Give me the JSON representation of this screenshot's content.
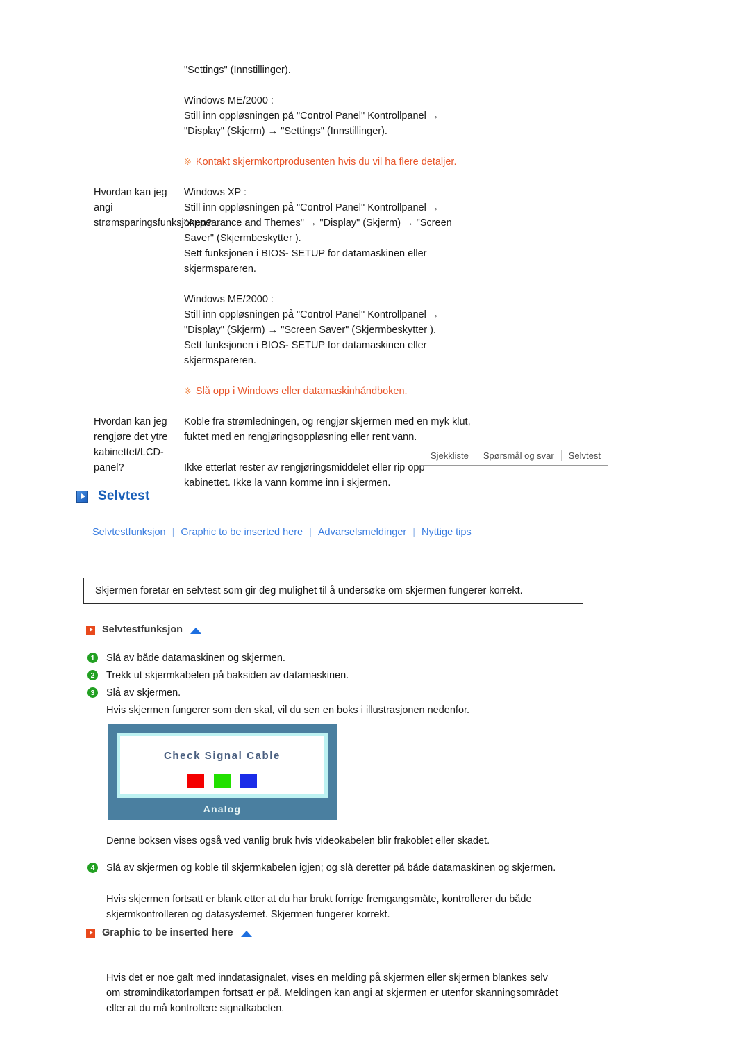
{
  "faq": {
    "rows": [
      {
        "question": "",
        "answer_blocks": [
          [
            "\"Settings\" (Innstillinger)."
          ],
          [
            "Windows ME/2000 :",
            "Still inn oppløsningen på \"Control Panel\" Kontrollpanel →",
            "\"Display\" (Skjerm) → \"Settings\" (Innstillinger)."
          ]
        ],
        "note": "Kontakt skjermkortprodusenten hvis du vil ha flere detaljer."
      },
      {
        "question_lines": [
          "Hvordan kan jeg angi",
          "strømsparingsfunksjonen?"
        ],
        "answer_blocks": [
          [
            "Windows XP :",
            "Still inn oppløsningen på \"Control Panel\" Kontrollpanel →",
            "\"Appearance and Themes\" → \"Display\" (Skjerm) → \"Screen",
            "Saver\" (Skjermbeskytter ).",
            "Sett funksjonen i BIOS- SETUP for datamaskinen eller",
            "skjermspareren."
          ],
          [
            "Windows ME/2000 :",
            "Still inn oppløsningen på \"Control Panel\" Kontrollpanel →",
            "\"Display\" (Skjerm) → \"Screen Saver\" (Skjermbeskytter ).",
            "Sett funksjonen i BIOS- SETUP for datamaskinen eller",
            "skjermspareren."
          ]
        ],
        "note": "Slå opp i Windows eller datamaskinhåndboken."
      },
      {
        "question_lines": [
          "Hvordan kan jeg rengjøre det ytre",
          "kabinettet/LCD-panel?"
        ],
        "answer_blocks": [
          [
            "Koble fra strømledningen, og rengjør skjermen med en myk klut,",
            "fuktet med en rengjøringsoppløsning eller rent vann."
          ],
          [
            "Ikke etterlat rester av rengjøringsmiddelet eller rip opp",
            "kabinettet. Ikke la vann komme inn i skjermen."
          ]
        ],
        "note": ""
      }
    ],
    "note_marker": "※"
  },
  "tabs": [
    {
      "label": "Sjekkliste"
    },
    {
      "label": "Spørsmål og svar"
    },
    {
      "label": "Selvtest"
    }
  ],
  "main_heading": {
    "title": "Selvtest"
  },
  "sublinks": [
    {
      "label": "Selvtestfunksjon"
    },
    {
      "label": "Graphic to be inserted here"
    },
    {
      "label": "Advarselsmeldinger"
    },
    {
      "label": "Nyttige tips"
    }
  ],
  "sublink_separator": "|",
  "infobox": {
    "text": "Skjermen foretar en selvtest som gir deg mulighet til å undersøke om skjermen fungerer korrekt."
  },
  "section_selvtestfunksjon": {
    "title": "Selvtestfunksjon",
    "steps": [
      {
        "num": "1",
        "text": "Slå av både datamaskinen og skjermen."
      },
      {
        "num": "2",
        "text": "Trekk ut skjermkabelen på baksiden av datamaskinen."
      },
      {
        "num": "3",
        "text": "Slå av skjermen."
      }
    ],
    "after_steps_text": "Hvis skjermen fungerer som den skal, vil du sen en boks i illustrasjonen nedenfor.",
    "below_image_text": "Denne boksen vises også ved vanlig bruk hvis videokabelen blir frakoblet eller skadet.",
    "step4": {
      "num": "4",
      "line1": "Slå av skjermen og koble til skjermkabelen igjen; og slå deretter på både datamaskinen og",
      "line2": "skjermen."
    },
    "closing_line1": "Hvis skjermen fortsatt er blank etter at du har brukt forrige fremgangsmåte, kontrollerer du både",
    "closing_line2": "skjermkontrolleren og datasystemet. Skjermen fungerer korrekt."
  },
  "monitor_image": {
    "screen_text": "Check Signal Cable",
    "label": "Analog",
    "swatch_colors": [
      "#f40000",
      "#22e000",
      "#1a2ce8"
    ],
    "bezel_color": "#4a7fa0",
    "inner_border_color": "#bdf2f2"
  },
  "section_graphic": {
    "title": "Graphic to be inserted here",
    "paragraph_lines": [
      "Hvis det er noe galt med inndatasignalet, vises en melding på skjermen eller skjermen blankes selv",
      "om strømindikatorlampen fortsatt er på. Meldingen kan angi at skjermen er utenfor skanningsområdet",
      "eller at du må kontrollere signalkabelen."
    ]
  },
  "colors": {
    "link_blue": "#3a7de0",
    "heading_blue": "#1a5fb8",
    "note_orange": "#e8552a",
    "bullet_green": "#22a022",
    "orange_box": "#e8491c"
  }
}
